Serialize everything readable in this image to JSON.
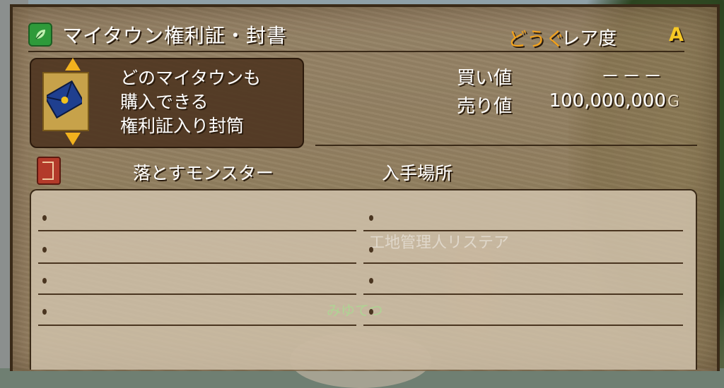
{
  "item": {
    "name": "マイタウン権利証・封書",
    "category": "どうぐ",
    "rarity_label": "レア度",
    "rarity": "A",
    "description": [
      "どのマイタウンも",
      "購入できる",
      "権利証入り封筒"
    ],
    "icon": "envelope-icon"
  },
  "prices": {
    "buy_label": "買い値",
    "buy_value": "－－－",
    "sell_label": "売り値",
    "sell_value": "100,000,000",
    "unit": "G"
  },
  "sources": {
    "monster_header": "落とすモンスター",
    "location_header": "入手場所",
    "monsters": [
      "",
      "",
      "",
      ""
    ],
    "locations": [
      "",
      "",
      "",
      ""
    ]
  },
  "background": {
    "sign_text": "工地管理人リステア",
    "player_name": "みゆてつ"
  },
  "colors": {
    "category": "#f3a21c",
    "rarity": "#f6c825",
    "panel": "#967e5c"
  }
}
